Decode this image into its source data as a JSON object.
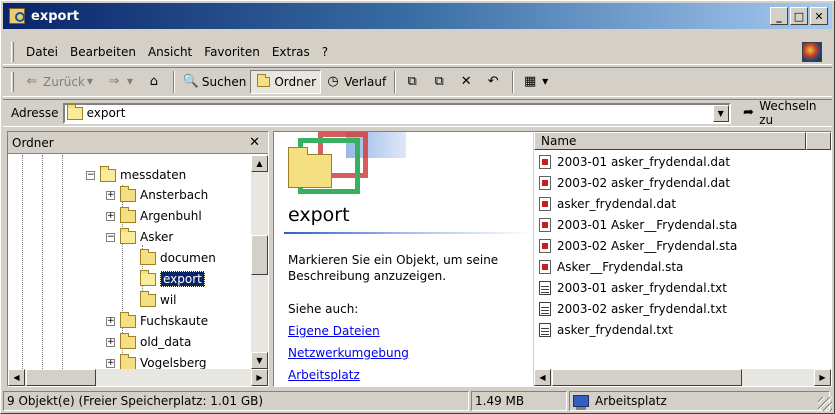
{
  "window": {
    "title": "export"
  },
  "menu": [
    "Datei",
    "Bearbeiten",
    "Ansicht",
    "Favoriten",
    "Extras",
    "?"
  ],
  "toolbar": {
    "back": "Zurück",
    "search": "Suchen",
    "folders": "Ordner",
    "history": "Verlauf"
  },
  "address": {
    "label": "Adresse",
    "value": "export",
    "go": "Wechseln zu"
  },
  "tree": {
    "header": "Ordner",
    "items": [
      {
        "label": "messdaten",
        "expander": "−"
      },
      {
        "label": "Ansterbach",
        "expander": "+"
      },
      {
        "label": "Argenbuhl",
        "expander": "+"
      },
      {
        "label": "Asker",
        "expander": "−"
      },
      {
        "label": "documen",
        "expander": ""
      },
      {
        "label": "export",
        "expander": ""
      },
      {
        "label": "wil",
        "expander": ""
      },
      {
        "label": "Fuchskaute",
        "expander": "+"
      },
      {
        "label": "old_data",
        "expander": "+"
      },
      {
        "label": "Vogelsberg",
        "expander": "+"
      }
    ]
  },
  "webview": {
    "title": "export",
    "description": "Markieren Sie ein Objekt, um seine Beschreibung anzuzeigen.",
    "see_also": "Siehe auch:",
    "links": [
      "Eigene Dateien",
      "Netzwerkumgebung",
      "Arbeitsplatz"
    ]
  },
  "filelist": {
    "column_name": "Name",
    "files": [
      {
        "name": "2003-01 asker_frydendal.dat",
        "type": "dat"
      },
      {
        "name": "2003-02 asker_frydendal.dat",
        "type": "dat"
      },
      {
        "name": "asker_frydendal.dat",
        "type": "dat"
      },
      {
        "name": "2003-01 Asker__Frydendal.sta",
        "type": "dat"
      },
      {
        "name": "2003-02 Asker__Frydendal.sta",
        "type": "dat"
      },
      {
        "name": "Asker__Frydendal.sta",
        "type": "dat"
      },
      {
        "name": "2003-01 asker_frydendal.txt",
        "type": "txt"
      },
      {
        "name": "2003-02 asker_frydendal.txt",
        "type": "txt"
      },
      {
        "name": "asker_frydendal.txt",
        "type": "txt"
      }
    ]
  },
  "status": {
    "objects": "9 Objekt(e) (Freier Speicherplatz: 1.01 GB)",
    "size": "1.49 MB",
    "zone": "Arbeitsplatz"
  }
}
